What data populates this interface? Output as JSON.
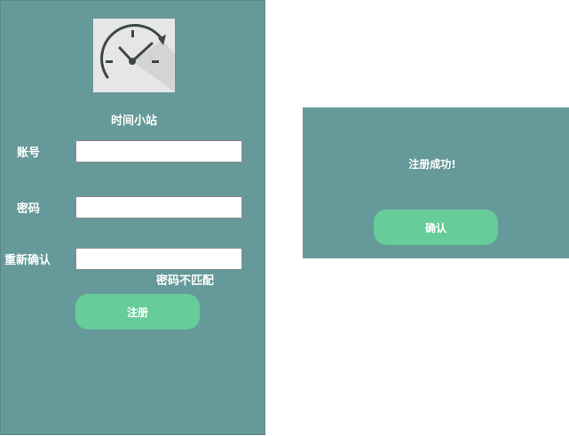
{
  "app": {
    "title": "时间小站",
    "logo_icon": "clock-gauge-icon"
  },
  "form": {
    "account_label": "账号",
    "account_value": "",
    "password_label": "密码",
    "password_value": "",
    "confirm_label": "重新确认",
    "confirm_value": "",
    "error_message": "密码不匹配",
    "register_button": "注册"
  },
  "dialog": {
    "message": "注册成功!",
    "confirm_button": "确认"
  },
  "colors": {
    "panel_bg": "#669999",
    "button_bg": "#66cc99",
    "text": "#ffffff"
  }
}
